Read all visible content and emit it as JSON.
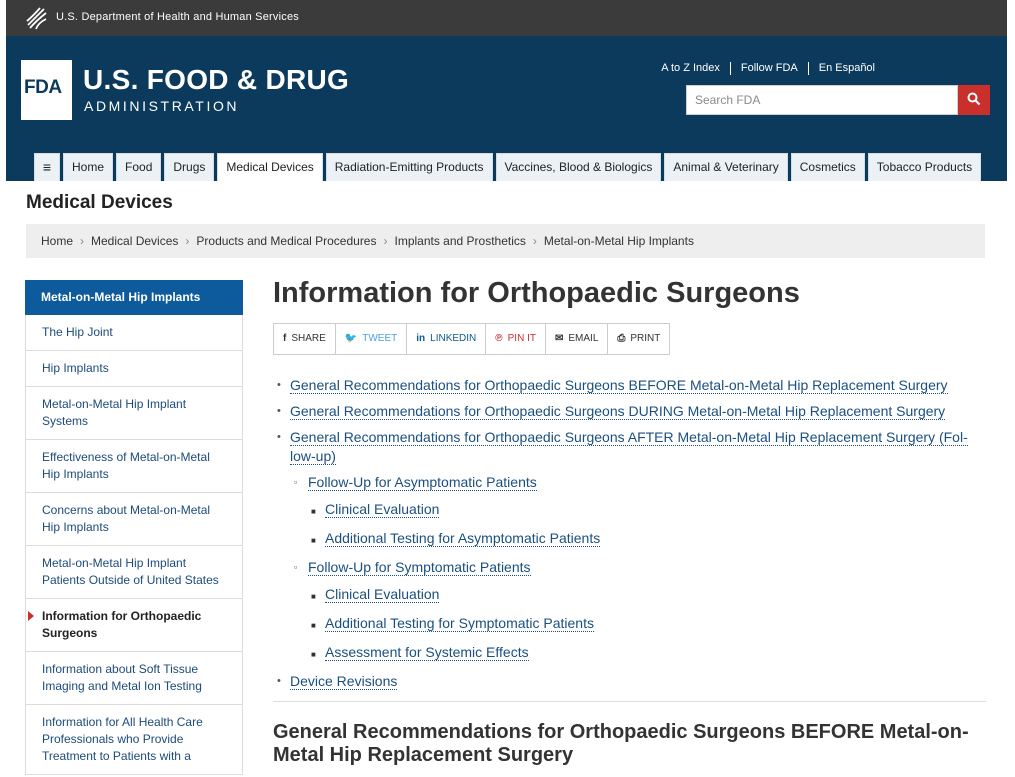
{
  "hhs": {
    "text": "U.S. Department of Health and Human Services",
    "icon": "hhs-eagle-icon"
  },
  "brand": {
    "logo_text": "FDA",
    "line1": "U.S. FOOD & DRUG",
    "line2": "ADMINISTRATION"
  },
  "utility_links": [
    "A to Z Index",
    "Follow FDA",
    "En Español"
  ],
  "search": {
    "placeholder": "Search FDA",
    "button_icon": "search-icon"
  },
  "nav": {
    "menu_icon": "≡",
    "tabs": [
      "Home",
      "Food",
      "Drugs",
      "Medical Devices",
      "Radiation-Emitting Products",
      "Vaccines, Blood & Biologics",
      "Animal & Veterinary",
      "Cosmetics",
      "Tobacco Products"
    ],
    "active_tab": "Medical Devices"
  },
  "section_title": "Medical Devices",
  "breadcrumb": [
    "Home",
    "Medical Devices",
    "Products and Medical Procedures",
    "Implants and Prosthetics",
    "Metal-on-Metal Hip Implants"
  ],
  "sidebar": {
    "heading": "Metal-on-Metal Hip Implants",
    "items": [
      "The Hip Joint",
      "Hip Implants",
      "Metal-on-Metal Hip Implant Systems",
      "Effectiveness of Metal-on-Metal Hip Implants",
      "Concerns about Metal-on-Metal Hip Implants",
      "Metal-on-Metal Hip Implant Patients Outside of United States",
      "Information for Orthopaedic Surgeons",
      "Information about Soft Tissue Imaging and Metal Ion Testing",
      "Information for All Health Care Professionals who Provide Treatment to Patients with a"
    ],
    "current_item": "Information for Orthopaedic Surgeons"
  },
  "page_title": "Information for Orthopaedic Surgeons",
  "share": [
    {
      "icon": "f",
      "label": "SHARE",
      "color": "#333333"
    },
    {
      "icon": "🐦",
      "label": "TWEET",
      "color": "#4aa3df"
    },
    {
      "icon": "in",
      "label": "LINKEDIN",
      "color": "#0e5a8a"
    },
    {
      "icon": "℗",
      "label": "PIN IT",
      "color": "#c9302c"
    },
    {
      "icon": "✉",
      "label": "EMAIL",
      "color": "#333333"
    },
    {
      "icon": "⎙",
      "label": "PRINT",
      "color": "#333333"
    }
  ],
  "toc": {
    "before": "General Recommendations for Orthopaedic Surgeons BEFORE Metal-on-Metal Hip Replacement Surgery",
    "during": "General Recommendations for Orthopaedic Surgeons DURING Metal-on-Metal Hip Replacement Surgery",
    "after": "General Recommendations for Orthopaedic Surgeons AFTER Metal-on-Metal Hip Replacement Surgery (Fol­low-up)",
    "asym": "Follow-Up for Asymptomatic Patients",
    "asym_clinical": "Clinical Evaluation",
    "asym_testing": "Additional Testing for Asymptomatic Patients",
    "sym": "Follow-Up for Symptomatic Patients",
    "sym_clinical": "Clinical Evaluation",
    "sym_testing": "Additional Testing for Symptomatic Patients",
    "sym_systemic": "Assessment for Systemic Effects",
    "revisions": "Device Revisions"
  },
  "section_heading": "General Recommendations for Orthopaedic Surgeons BEFORE Metal-on-Metal Hip Replacement Surgery"
}
